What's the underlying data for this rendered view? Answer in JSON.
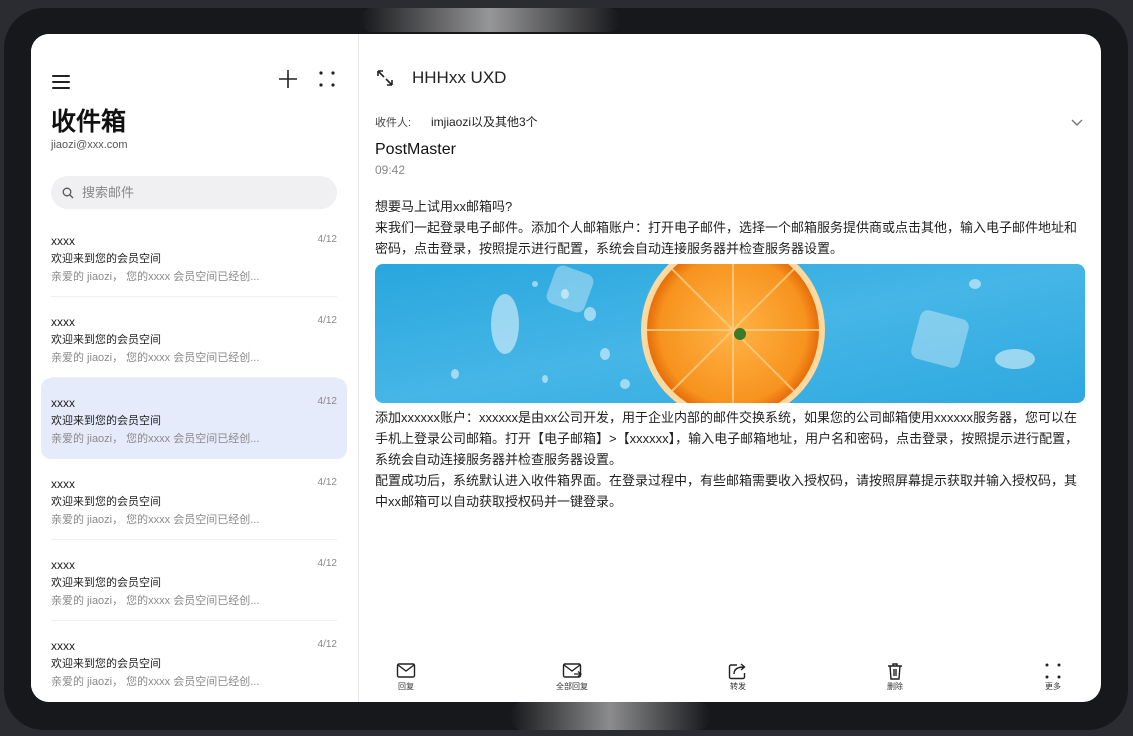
{
  "sidebar": {
    "title": "收件箱",
    "account": "jiaozi@xxx.com",
    "search_placeholder": "搜索邮件",
    "mails": [
      {
        "sender": "xxxx",
        "date": "4/12",
        "subject": "欢迎来到您的会员空间",
        "preview": "亲爱的 jiaozi，  您的xxxx 会员空间已经创..."
      },
      {
        "sender": "xxxx",
        "date": "4/12",
        "subject": "欢迎来到您的会员空间",
        "preview": "亲爱的 jiaozi，  您的xxxx 会员空间已经创..."
      },
      {
        "sender": "xxxx",
        "date": "4/12",
        "subject": "欢迎来到您的会员空间",
        "preview": "亲爱的 jiaozi，  您的xxxx 会员空间已经创..."
      },
      {
        "sender": "xxxx",
        "date": "4/12",
        "subject": "欢迎来到您的会员空间",
        "preview": "亲爱的 jiaozi，  您的xxxx 会员空间已经创..."
      },
      {
        "sender": "xxxx",
        "date": "4/12",
        "subject": "欢迎来到您的会员空间",
        "preview": "亲爱的 jiaozi，  您的xxxx 会员空间已经创..."
      },
      {
        "sender": "xxxx",
        "date": "4/12",
        "subject": "欢迎来到您的会员空间",
        "preview": "亲爱的 jiaozi，  您的xxxx 会员空间已经创..."
      }
    ],
    "selected_index": 2
  },
  "detail": {
    "title": "HHHxx UXD",
    "recipient_label": "收件人:",
    "recipients": "imjiaozi以及其他3个",
    "from": "PostMaster",
    "time": "09:42",
    "body_top": "想要马上试用xx邮箱吗?\n来我们一起登录电子邮件。添加个人邮箱账户：打开电子邮件，选择一个邮箱服务提供商或点击其他，输入电子邮件地址和密码，点击登录，按照提示进行配置，系统会自动连接服务器并检查服务器设置。",
    "body_bottom": "添加xxxxxx账户：xxxxxx是由xx公司开发，用于企业内部的邮件交换系统，如果您的公司邮箱使用xxxxxx服务器，您可以在手机上登录公司邮箱。打开【电子邮箱】>【xxxxxx】，输入电子邮箱地址，用户名和密码，点击登录，按照提示进行配置，系统会自动连接服务器并检查服务器设置。\n配置成功后，系统默认进入收件箱界面。在登录过程中，有些邮箱需要收入授权码，请按照屏幕提示获取并输入授权码，其中xx邮箱可以自动获取授权码并一键登录。"
  },
  "toolbar": {
    "reply": "回复",
    "reply_all": "全部回复",
    "forward": "转发",
    "delete": "删除",
    "more": "更多"
  },
  "colors": {
    "selected_bg": "#e6ebfb",
    "banner_blue": "#3fb0e3",
    "orange": "#f7931e"
  }
}
